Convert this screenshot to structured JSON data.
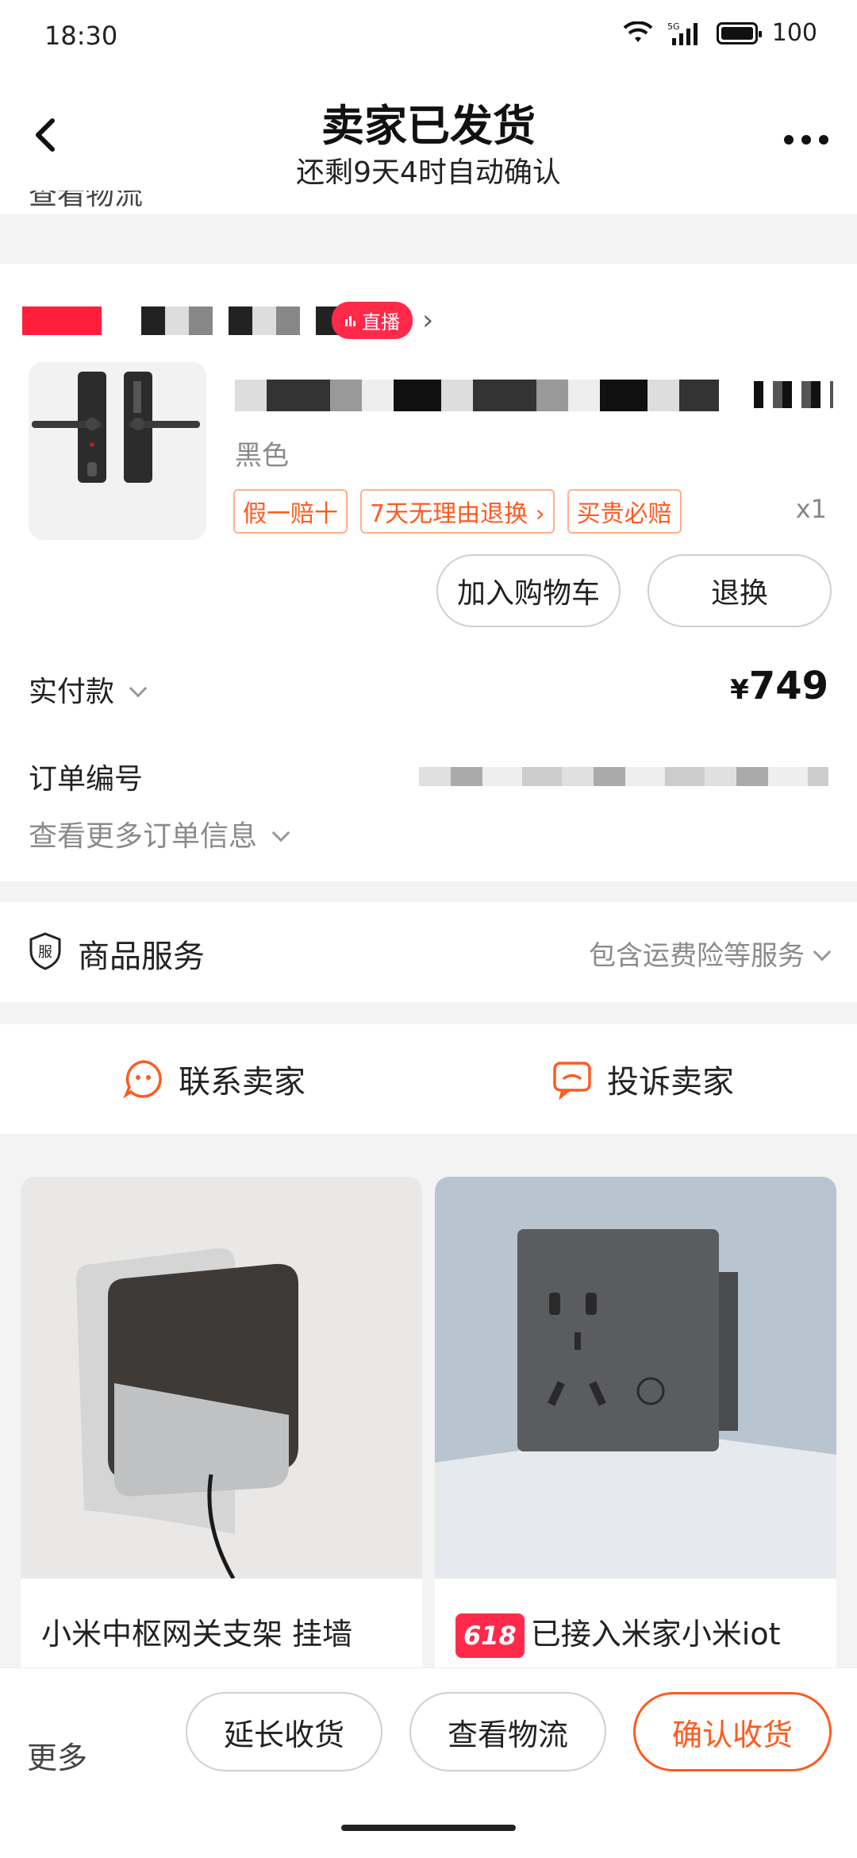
{
  "status_bar": {
    "time": "18:30",
    "network": "5G",
    "battery": "100"
  },
  "header": {
    "title": "卖家已发货",
    "subtitle": "还剩9天4时自动确认",
    "cut_text": "查看物流"
  },
  "order": {
    "live_badge": "直播",
    "variant": "黑色",
    "tags": [
      "假一赔十",
      "7天无理由退换 ›",
      "买贵必赔"
    ],
    "quantity": "x1",
    "add_to_cart": "加入购物车",
    "return_label": "退换",
    "paid_label": "实付款",
    "paid_currency": "¥",
    "paid_amount": "749",
    "order_no_label": "订单编号",
    "more_info": "查看更多订单信息"
  },
  "service": {
    "icon_text": "服",
    "label": "商品服务",
    "value": "包含运费险等服务"
  },
  "contact": {
    "contact_seller": "联系卖家",
    "complain_seller": "投诉卖家"
  },
  "recommendations": [
    {
      "title": "小米中枢网关支架 挂墙",
      "badge": ""
    },
    {
      "title": "已接入米家小米iot",
      "badge": "618"
    }
  ],
  "bottom_bar": {
    "more": "更多",
    "extend": "延长收货",
    "track": "查看物流",
    "confirm": "确认收货"
  },
  "colors": {
    "accent": "#ff5a1f",
    "live": "#ff2a4a"
  }
}
